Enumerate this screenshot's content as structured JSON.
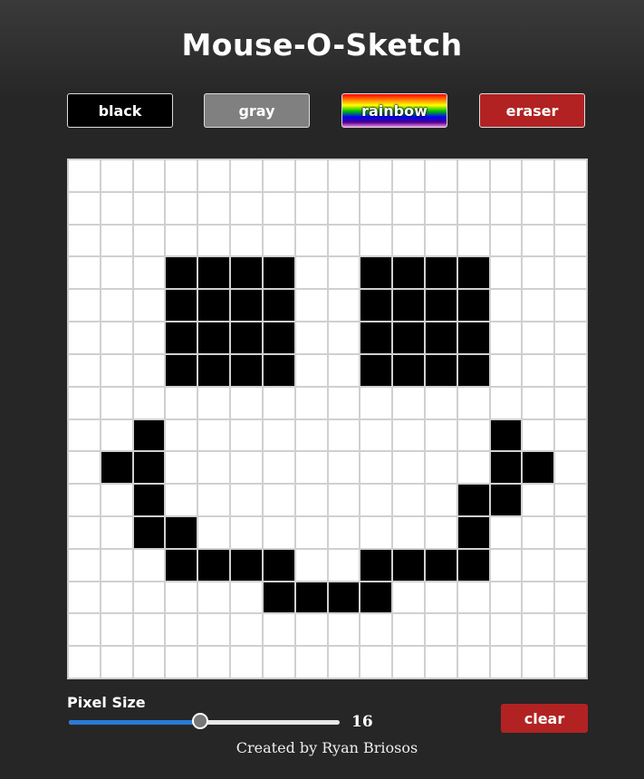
{
  "title": "Mouse-O-Sketch",
  "colors": {
    "black_btn": "#000000",
    "gray_btn": "#808080",
    "eraser_btn": "#b22222",
    "clear_btn": "#b22222",
    "filled_pixel": "#000000",
    "empty_pixel": "#ffffff",
    "slider_fill": "#2a7bd6"
  },
  "buttons": {
    "black": "black",
    "gray": "gray",
    "rainbow": "rainbow",
    "eraser": "eraser",
    "clear": "clear"
  },
  "pixel_size": {
    "label": "Pixel Size",
    "value": "16",
    "min": 1,
    "max": 32,
    "current": 16
  },
  "grid": {
    "size": 16,
    "filled": [
      [
        3,
        3
      ],
      [
        3,
        4
      ],
      [
        3,
        5
      ],
      [
        3,
        6
      ],
      [
        3,
        9
      ],
      [
        3,
        10
      ],
      [
        3,
        11
      ],
      [
        3,
        12
      ],
      [
        4,
        3
      ],
      [
        4,
        4
      ],
      [
        4,
        5
      ],
      [
        4,
        6
      ],
      [
        4,
        9
      ],
      [
        4,
        10
      ],
      [
        4,
        11
      ],
      [
        4,
        12
      ],
      [
        5,
        3
      ],
      [
        5,
        4
      ],
      [
        5,
        5
      ],
      [
        5,
        6
      ],
      [
        5,
        9
      ],
      [
        5,
        10
      ],
      [
        5,
        11
      ],
      [
        5,
        12
      ],
      [
        6,
        3
      ],
      [
        6,
        4
      ],
      [
        6,
        5
      ],
      [
        6,
        6
      ],
      [
        6,
        9
      ],
      [
        6,
        10
      ],
      [
        6,
        11
      ],
      [
        6,
        12
      ],
      [
        8,
        2
      ],
      [
        8,
        13
      ],
      [
        9,
        1
      ],
      [
        9,
        2
      ],
      [
        9,
        13
      ],
      [
        9,
        14
      ],
      [
        10,
        2
      ],
      [
        10,
        12
      ],
      [
        10,
        13
      ],
      [
        11,
        2
      ],
      [
        11,
        3
      ],
      [
        11,
        12
      ],
      [
        12,
        3
      ],
      [
        12,
        4
      ],
      [
        12,
        5
      ],
      [
        12,
        6
      ],
      [
        12,
        9
      ],
      [
        12,
        10
      ],
      [
        12,
        11
      ],
      [
        12,
        12
      ],
      [
        13,
        6
      ],
      [
        13,
        7
      ],
      [
        13,
        8
      ],
      [
        13,
        9
      ]
    ]
  },
  "footer": "Created by Ryan Briosos"
}
